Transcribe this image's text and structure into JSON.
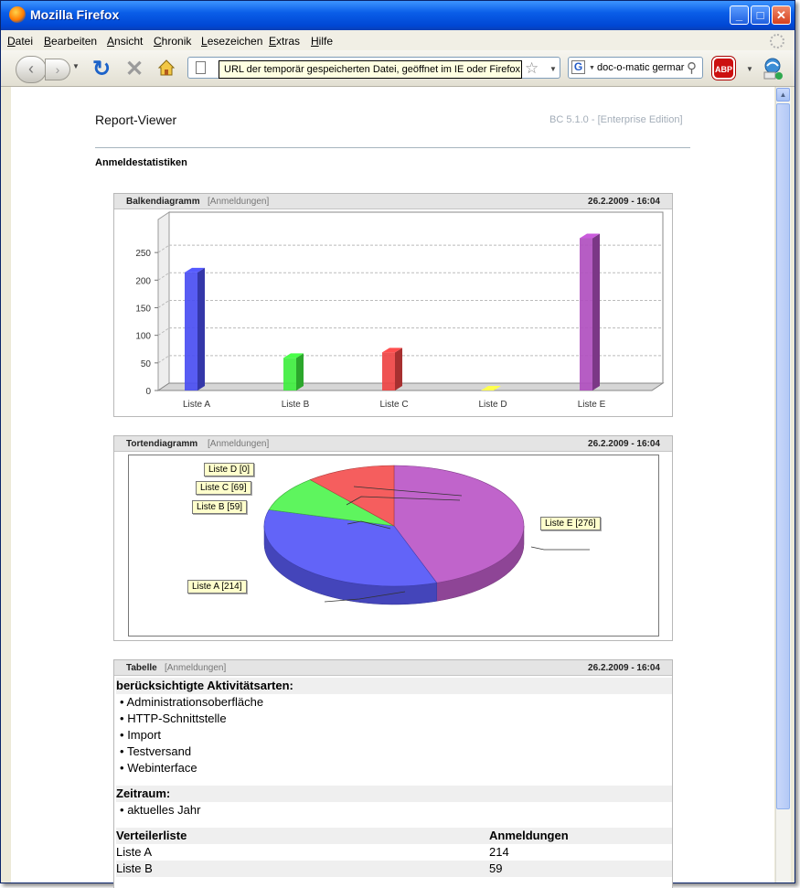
{
  "window": {
    "title": "Mozilla Firefox",
    "min": "_",
    "max": "□",
    "close": "✕"
  },
  "menu": [
    "Datei",
    "Bearbeiten",
    "Ansicht",
    "Chronik",
    "Lesezeichen",
    "Extras",
    "Hilfe"
  ],
  "toolbar": {
    "tooltip": "URL der temporär gespeicherten Datei, geöffnet im IE oder Firefox",
    "search_value": "doc-o-matic germar",
    "search_engine": "G",
    "adblock": "ABP"
  },
  "report": {
    "title": "Report-Viewer",
    "edition": "BC 5.1.0 - [Enterprise Edition]",
    "section": "Anmeldestatistiken"
  },
  "panels": {
    "bar": {
      "title": "Balkendiagramm",
      "sub": "[Anmeldungen]",
      "date": "26.2.2009 - 16:04"
    },
    "pie": {
      "title": "Tortendiagramm",
      "sub": "[Anmeldungen]",
      "date": "26.2.2009 - 16:04"
    },
    "table": {
      "title": "Tabelle",
      "sub": "[Anmeldungen]",
      "date": "26.2.2009 - 16:04"
    }
  },
  "chart_data": [
    {
      "type": "bar",
      "categories": [
        "Liste A",
        "Liste B",
        "Liste C",
        "Liste D",
        "Liste E"
      ],
      "values": [
        214,
        59,
        69,
        0,
        276
      ],
      "colors": [
        "#4a4ef2",
        "#3fee3f",
        "#ee4444",
        "#eeee44",
        "#b04fbf"
      ],
      "yticks": [
        0,
        50,
        100,
        150,
        200,
        250
      ],
      "ylim": [
        0,
        290
      ],
      "grid": true
    },
    {
      "type": "pie",
      "categories": [
        "Liste A",
        "Liste B",
        "Liste C",
        "Liste D",
        "Liste E"
      ],
      "values": [
        214,
        59,
        69,
        0,
        276
      ],
      "labels": [
        "Liste A [214]",
        "Liste B [59]",
        "Liste C [69]",
        "Liste D [0]",
        "Liste E [276]"
      ],
      "colors": [
        "#5a5cf8",
        "#55f455",
        "#f45555",
        "#eeee44",
        "#bd5cc8"
      ]
    }
  ],
  "table": {
    "activities_heading": "berücksichtigte Aktivitätsarten:",
    "activities": [
      "Administrationsoberfläche",
      "HTTP-Schnittstelle",
      "Import",
      "Testversand",
      "Webinterface"
    ],
    "period_heading": "Zeitraum:",
    "period": [
      "aktuelles Jahr"
    ],
    "columns": [
      "Verteilerliste",
      "Anmeldungen"
    ],
    "rows": [
      [
        "Liste A",
        "214"
      ],
      [
        "Liste B",
        "59"
      ]
    ]
  },
  "bullet": "•"
}
